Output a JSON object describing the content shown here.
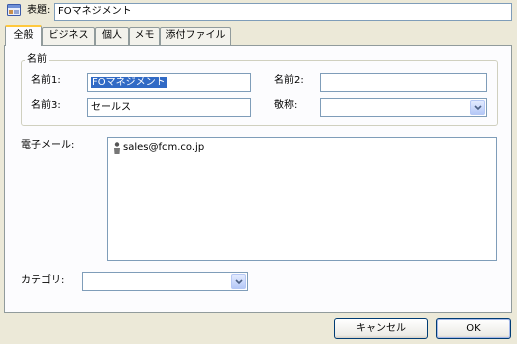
{
  "header": {
    "subject_label": "表題:",
    "subject_value": "FOマネジメント"
  },
  "tabs": [
    {
      "label": "全般",
      "active": true
    },
    {
      "label": "ビジネス",
      "active": false
    },
    {
      "label": "個人",
      "active": false
    },
    {
      "label": "メモ",
      "active": false
    },
    {
      "label": "添付ファイル",
      "active": false
    }
  ],
  "name_group": {
    "legend": "名前",
    "name1_label": "名前1:",
    "name1_value": "FOマネジメント",
    "name2_label": "名前2:",
    "name2_value": "",
    "name3_label": "名前3:",
    "name3_value": "セールス",
    "title_label": "敬称:",
    "title_value": ""
  },
  "email": {
    "label": "電子メール:",
    "entries": [
      "sales@fcm.co.jp"
    ]
  },
  "category": {
    "label": "カテゴリ:",
    "value": ""
  },
  "buttons": {
    "cancel": "キャンセル",
    "ok": "OK"
  },
  "icons": {
    "header": "card-icon",
    "email_entry": "person-icon",
    "dropdown": "chevron-down-icon"
  },
  "colors": {
    "accent": "#ffc83c",
    "selection": "#316ac5",
    "border": "#7f9db9"
  }
}
